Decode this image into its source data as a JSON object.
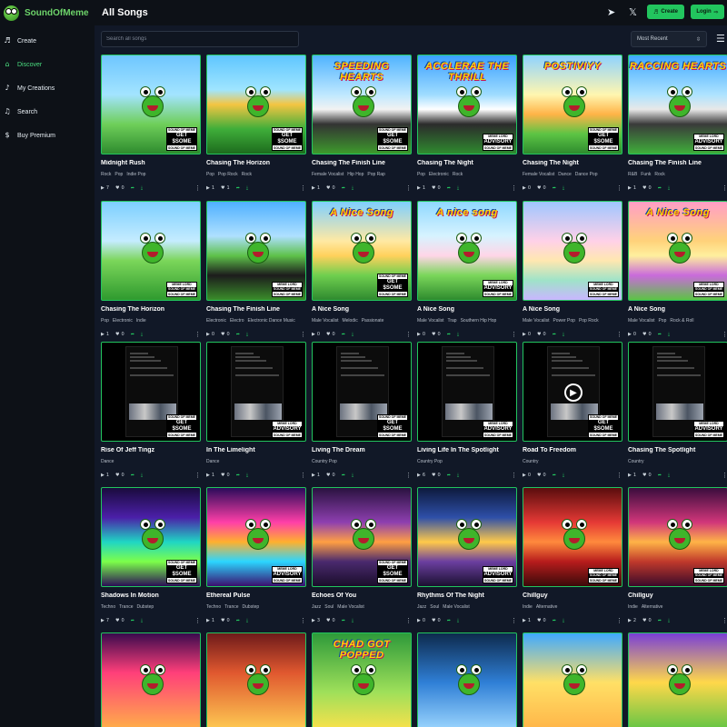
{
  "app": {
    "name": "SoundOfMeme"
  },
  "sidebar": {
    "items": [
      {
        "label": "Create",
        "icon": "music-note-icon",
        "glyph": "♬",
        "active": false
      },
      {
        "label": "Discover",
        "icon": "home-icon",
        "glyph": "⌂",
        "active": true
      },
      {
        "label": "My Creations",
        "icon": "music-note-icon",
        "glyph": "♪",
        "active": false
      },
      {
        "label": "Search",
        "icon": "music-search-icon",
        "glyph": "♫",
        "active": false
      },
      {
        "label": "Buy Premium",
        "icon": "dollar-circle-icon",
        "glyph": "$",
        "active": false
      }
    ]
  },
  "header": {
    "title": "All Songs",
    "create_label": "Create",
    "login_label": "Login",
    "telegram_icon": "➤",
    "x_icon": "𝕏"
  },
  "toolbar": {
    "search_placeholder": "Search all songs",
    "sort_value": "Most Recent",
    "sort_chevron": "⇳",
    "list_icon": "☰"
  },
  "colors": {
    "accent": "#22c55e",
    "background": "#111827",
    "sidebar": "#0d1117"
  },
  "badge": {
    "top": "SOUND OF MEME",
    "get": "GET $SOME",
    "meme": "MEME LORD",
    "advisory": "ADVISORY"
  },
  "rows": [
    {
      "songs": [
        {
          "title": "Midnight Rush",
          "tags": [
            "Rock",
            "Pop",
            "Indie Pop"
          ],
          "plays": "7",
          "likes": "0",
          "cover_text": "",
          "bg": "linear-gradient(180deg,#6ec6ff 0%,#a3e4ff 40%,#6fcf5a 70%,#2e8b2e 100%)",
          "badge": "get"
        },
        {
          "title": "Chasing The Horizon",
          "tags": [
            "Pop",
            "Pop Rock",
            "Rock"
          ],
          "plays": "1",
          "likes": "1",
          "cover_text": "",
          "bg": "linear-gradient(180deg,#5fc6ff 0%,#9fe5ff 35%,#f4c542 50%,#3fae3a 75%,#1d6b1d 100%)",
          "badge": "get"
        },
        {
          "title": "Chasing The Finish Line",
          "tags": [
            "Female Vocalist",
            "Hip Hop",
            "Pop Rap"
          ],
          "plays": "1",
          "likes": "0",
          "cover_text": "SPEEDING HEARTS",
          "bg": "linear-gradient(180deg,#4fb3ff 0%,#bfe8ff 40%,#f2f2f2 55%,#333 70%,#3d9a2c 100%)",
          "badge": "get"
        },
        {
          "title": "Chasing The Night",
          "tags": [
            "Pop",
            "Electronic",
            "Rock"
          ],
          "plays": "1",
          "likes": "0",
          "cover_text": "ACCLERAE THE THRILL",
          "bg": "linear-gradient(180deg,#3aa0ff 0%,#9fdcff 40%,#ffffff 55%,#2b2b2b 70%,#2f8a2f 100%)",
          "badge": "advisory"
        },
        {
          "title": "Chasing The Night",
          "tags": [
            "Female Vocalist",
            "Dance",
            "Dance Pop"
          ],
          "plays": "0",
          "likes": "0",
          "cover_text": "POSTIVIYY",
          "bg": "linear-gradient(180deg,#8fd3ff 0%,#fff6b0 40%,#ffb347 60%,#5cc444 80%,#2e8b2e 100%)",
          "badge": "get"
        },
        {
          "title": "Chasing The Finish Line",
          "tags": [
            "R&B",
            "Funk",
            "Rock"
          ],
          "plays": "1",
          "likes": "0",
          "cover_text": "RACCING HEARTS",
          "bg": "linear-gradient(180deg,#3fa9ff 0%,#aee3ff 40%,#e8e8e8 55%,#3a3a3a 70%,#3fae3a 100%)",
          "badge": "advisory"
        }
      ]
    },
    {
      "songs": [
        {
          "title": "Chasing The Horizon",
          "tags": [
            "Pop",
            "Electronic",
            "Indie"
          ],
          "plays": "1",
          "likes": "0",
          "cover_text": "",
          "bg": "linear-gradient(180deg,#7ccfff 0%,#c5ecff 40%,#7bd65a 60%,#2f9a2f 100%)",
          "badge": "meme"
        },
        {
          "title": "Chasing The Finish Line",
          "tags": [
            "Electronic",
            "Electro",
            "Electronic Dance Music"
          ],
          "plays": "0",
          "likes": "0",
          "cover_text": "",
          "bg": "linear-gradient(180deg,#4fb0ff 0%,#aee0ff 35%,#5ec24a 55%,#1c1c1c 75%,#3a8d2a 100%)",
          "badge": "meme"
        },
        {
          "title": "A Nice Song",
          "tags": [
            "Male Vocalist",
            "Melodic",
            "Passionate"
          ],
          "plays": "0",
          "likes": "0",
          "cover_text": "A Nice Song",
          "bg": "linear-gradient(180deg,#7fcfff 0%,#ffe9a3 40%,#ffd15c 55%,#6fcf4f 75%,#2f8a2f 100%)",
          "badge": "get"
        },
        {
          "title": "A Nice Song",
          "tags": [
            "Male Vocalist",
            "Trap",
            "Southern Hip Hop"
          ],
          "plays": "0",
          "likes": "0",
          "cover_text": "A nice song",
          "bg": "linear-gradient(180deg,#8fd8ff 0%,#d7f3ff 35%,#ffd6e7 55%,#7ad65a 75%,#2e8b2e 100%)",
          "badge": "advisory"
        },
        {
          "title": "A Nice Song",
          "tags": [
            "Male Vocalist",
            "Power Pop",
            "Pop Rock"
          ],
          "plays": "0",
          "likes": "0",
          "cover_text": "",
          "bg": "linear-gradient(180deg,#9fc6ff 0%,#ffd1e8 40%,#ffe7b0 60%,#9fe3c8 80%,#c9b6ff 100%)",
          "badge": "meme"
        },
        {
          "title": "A Nice Song",
          "tags": [
            "Male Vocalist",
            "Pop",
            "Rock & Roll"
          ],
          "plays": "0",
          "likes": "0",
          "cover_text": "A Nice Song",
          "bg": "linear-gradient(180deg,#ff9ec7 0%,#ffd27a 40%,#ffef9e 55%,#c96bdb 75%,#5cc444 100%)",
          "badge": "meme"
        }
      ]
    },
    {
      "songs": [
        {
          "title": "Rise Of Jeff Tingz",
          "tags": [
            "Dance"
          ],
          "plays": "1",
          "likes": "0",
          "video": true,
          "play": false,
          "badge": "get"
        },
        {
          "title": "In The Limelight",
          "tags": [
            "Dance"
          ],
          "plays": "1",
          "likes": "0",
          "video": true,
          "play": false,
          "badge": "advisory"
        },
        {
          "title": "Living The Dream",
          "tags": [
            "Country Pop"
          ],
          "plays": "1",
          "likes": "0",
          "video": true,
          "play": false,
          "badge": "get"
        },
        {
          "title": "Living Life In The Spotlight",
          "tags": [
            "Country Pop"
          ],
          "plays": "6",
          "likes": "0",
          "video": true,
          "play": false,
          "badge": "advisory"
        },
        {
          "title": "Road To Freedom",
          "tags": [
            "Country"
          ],
          "plays": "0",
          "likes": "0",
          "video": true,
          "play": true,
          "badge": "get"
        },
        {
          "title": "Chasing The Spotlight",
          "tags": [
            "Country"
          ],
          "plays": "1",
          "likes": "0",
          "video": true,
          "play": false,
          "badge": "advisory"
        }
      ]
    },
    {
      "songs": [
        {
          "title": "Shadows In Motion",
          "tags": [
            "Techno",
            "Trance",
            "Dubstep"
          ],
          "plays": "7",
          "likes": "0",
          "cover_text": "",
          "bg": "linear-gradient(180deg,#1a0b3d 0%,#4b1fa8 30%,#1fd6c4 55%,#7cff4a 75%,#2a0e55 100%)",
          "badge": "get"
        },
        {
          "title": "Ethereal Pulse",
          "tags": [
            "Techno",
            "Trance",
            "Dubstep"
          ],
          "plays": "1",
          "likes": "0",
          "cover_text": "",
          "bg": "linear-gradient(180deg,#2a0b5a 0%,#ff3fa8 35%,#ffb02e 55%,#2bd6ff 75%,#3a0e6e 100%)",
          "badge": "advisory"
        },
        {
          "title": "Echoes Of You",
          "tags": [
            "Jazz",
            "Soul",
            "Male Vocalist"
          ],
          "plays": "3",
          "likes": "0",
          "cover_text": "",
          "bg": "linear-gradient(180deg,#2a1240 0%,#8e3fb0 35%,#ff9f43 55%,#4a2a6e 75%,#1a0d2a 100%)",
          "badge": "get"
        },
        {
          "title": "Rhythms Of The Night",
          "tags": [
            "Jazz",
            "Soul",
            "Male Vocalist"
          ],
          "plays": "0",
          "likes": "0",
          "cover_text": "",
          "bg": "linear-gradient(180deg,#0d1a3d 0%,#2e4fa8 30%,#ffc94a 55%,#6b3fa0 75%,#1a1030 100%)",
          "badge": "advisory"
        },
        {
          "title": "Chillguy",
          "tags": [
            "Indie",
            "Alternative"
          ],
          "plays": "1",
          "likes": "0",
          "cover_text": "",
          "bg": "linear-gradient(180deg,#5a0d0d 0%,#e53935 35%,#ff8a3d 55%,#b71c1c 75%,#3a0a0a 100%)",
          "badge": "meme"
        },
        {
          "title": "Chillguy",
          "tags": [
            "Indie",
            "Alternative"
          ],
          "plays": "2",
          "likes": "0",
          "cover_text": "",
          "bg": "linear-gradient(180deg,#3a0d3d 0%,#d1367a 35%,#ffb347 55%,#c0392b 75%,#3a0a2a 100%)",
          "badge": "meme"
        }
      ]
    },
    {
      "songs": [
        {
          "title": "",
          "tags": [],
          "plays": "",
          "likes": "",
          "cover_text": "",
          "bg": "linear-gradient(180deg,#3a0a4d 0%,#ff3f7a 40%,#ffb347 100%)",
          "badge": ""
        },
        {
          "title": "",
          "tags": [],
          "plays": "",
          "likes": "",
          "cover_text": "",
          "bg": "linear-gradient(180deg,#6e1a1a 0%,#e0582f 40%,#ffce54 100%)",
          "badge": ""
        },
        {
          "title": "",
          "tags": [],
          "plays": "",
          "likes": "",
          "cover_text": "CHAD GOT POPPED",
          "bg": "linear-gradient(180deg,#2e9a3a 0%,#9fe05a 60%,#ffe14a 100%)",
          "badge": ""
        },
        {
          "title": "",
          "tags": [],
          "plays": "",
          "likes": "",
          "cover_text": "",
          "bg": "linear-gradient(180deg,#0d2a4d 0%,#2f7fd6 50%,#9fd8ff 100%)",
          "badge": ""
        },
        {
          "title": "",
          "tags": [],
          "plays": "",
          "likes": "",
          "cover_text": "",
          "bg": "linear-gradient(180deg,#3fa9ff 0%,#ffe066 50%,#ffb347 100%)",
          "badge": ""
        },
        {
          "title": "",
          "tags": [],
          "plays": "",
          "likes": "",
          "cover_text": "",
          "bg": "linear-gradient(180deg,#7a3fd6 0%,#ffd84a 50%,#5cc444 100%)",
          "badge": ""
        }
      ]
    }
  ]
}
